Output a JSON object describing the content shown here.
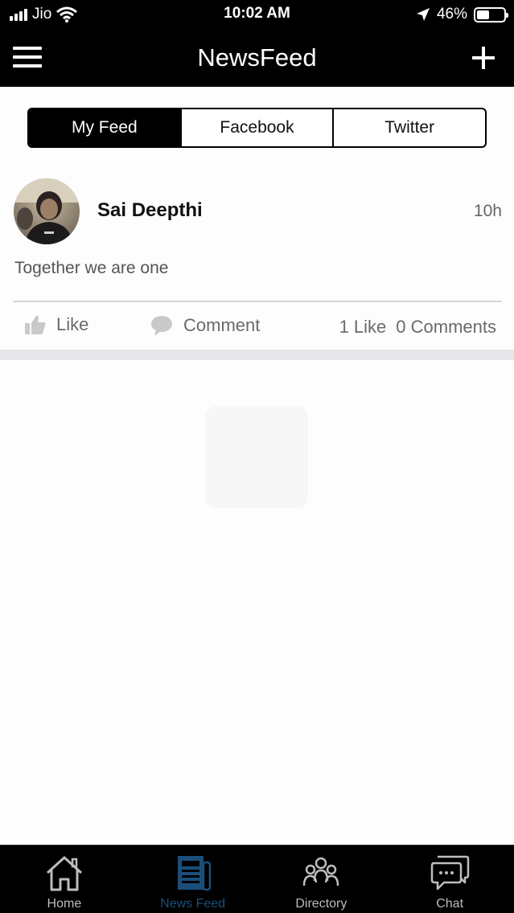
{
  "status_bar": {
    "carrier": "Jio",
    "time": "10:02 AM",
    "battery": "46%",
    "battery_level": 0.46
  },
  "navbar": {
    "title": "NewsFeed",
    "menu_icon": "hamburger-menu-icon",
    "add_icon": "plus-icon"
  },
  "tabs": [
    {
      "label": "My Feed",
      "active": true
    },
    {
      "label": "Facebook",
      "active": false
    },
    {
      "label": "Twitter",
      "active": false
    }
  ],
  "post": {
    "author": "Sai Deepthi",
    "time": "10h",
    "text": "Together we are one",
    "like_label": "Like",
    "comment_label": "Comment",
    "likes_count": "1 Like",
    "comments_count": "0 Comments"
  },
  "bottom_tabs": [
    {
      "label": "Home",
      "icon": "home-icon",
      "active": false
    },
    {
      "label": "News Feed",
      "icon": "newspaper-icon",
      "active": true
    },
    {
      "label": "Directory",
      "icon": "people-icon",
      "active": false
    },
    {
      "label": "Chat",
      "icon": "chat-bubble-icon",
      "active": false
    }
  ],
  "colors": {
    "bar_background": "#000000",
    "active_tab": "#1a4f7a",
    "inactive_tab": "#bdbdbd"
  }
}
